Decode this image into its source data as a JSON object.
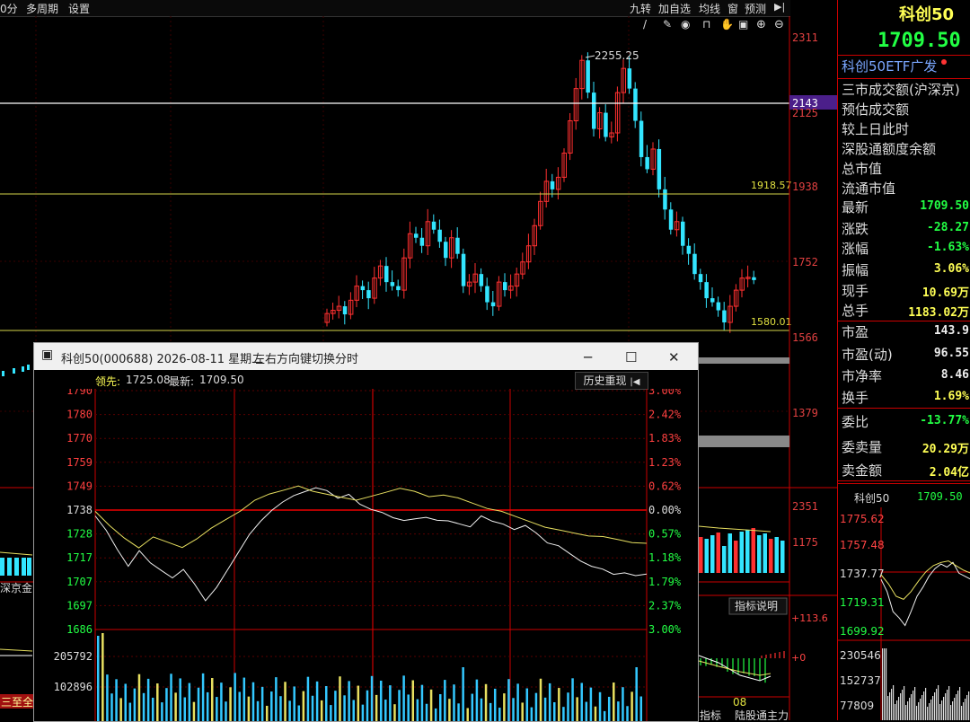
{
  "toolbar": {
    "left_items": [
      "0分",
      "多周期",
      "设置"
    ],
    "right_items": [
      "九转",
      "加自选",
      "均线",
      "窗",
      "预测"
    ]
  },
  "main_chart": {
    "price_axis": [
      "2311",
      "2143",
      "2125",
      "1938",
      "1752",
      "1566",
      "1379"
    ],
    "highlight_price": "2143",
    "annotation_high": "2255.25",
    "line_label_upper": "1918.57",
    "line_label_lower": "1580.01",
    "volume_axis": [
      "2351",
      "1175"
    ],
    "indicator_btn": "指标说明",
    "indicator_axis": [
      "+113.6",
      "+0"
    ],
    "date_label": "08",
    "bottom_tabs": [
      "指标",
      "陆股通主力"
    ],
    "left_bottom_label": "深京金",
    "left_bottom_badge": "三至全"
  },
  "right_panel": {
    "title": "科创50",
    "price": "1709.50",
    "etf": "科创50ETF广发",
    "info_rows": [
      "三市成交额(沪深京)",
      "预估成交额",
      "较上日此时",
      "深股通额度余额",
      "总市值",
      "流通市值"
    ],
    "stats": [
      {
        "label": "最新",
        "value": "1709.50",
        "color": "#22ff44"
      },
      {
        "label": "涨跌",
        "value": "-28.27",
        "color": "#22ff44"
      },
      {
        "label": "涨幅",
        "value": "-1.63%",
        "color": "#22ff44"
      },
      {
        "label": "振幅",
        "value": "3.06%",
        "color": "#ffff55"
      },
      {
        "label": "现手",
        "value": "10.69万",
        "color": "#ffff55"
      },
      {
        "label": "总手",
        "value": "1183.02万",
        "color": "#ffff55"
      },
      {
        "label": "市盈",
        "value": "143.9",
        "color": "#eeeeee"
      },
      {
        "label": "市盈(动)",
        "value": "96.55",
        "color": "#eeeeee"
      },
      {
        "label": "市净率",
        "value": "8.46",
        "color": "#eeeeee"
      },
      {
        "label": "换手",
        "value": "1.69%",
        "color": "#ffff55"
      },
      {
        "label": "委比",
        "value": "-13.77%",
        "color": "#22ff44"
      },
      {
        "label": "委卖量",
        "value": "20.29万",
        "color": "#ffff55"
      },
      {
        "label": "卖金额",
        "value": "2.04亿",
        "color": "#ffff55"
      }
    ],
    "mini_title": "科创50",
    "mini_price": "1709.50",
    "mini_axis": [
      "1775.62",
      "1757.48",
      "1737.77",
      "1719.31",
      "1699.92"
    ],
    "mini_vol_axis": [
      "230546",
      "152737",
      "77809"
    ]
  },
  "popup": {
    "title": "科创50(000688) 2026-08-11 星期二",
    "hint": "左右方向键切换分时",
    "lead_label": "领先:",
    "lead_value": "1725.08",
    "latest_label": "最新:",
    "latest_value": "1709.50",
    "history_btn": "历史重现",
    "price_axis": [
      "1790",
      "1780",
      "1770",
      "1759",
      "1749",
      "1738",
      "1728",
      "1717",
      "1707",
      "1697",
      "1686"
    ],
    "pct_axis": [
      "3.00%",
      "2.42%",
      "1.83%",
      "1.23%",
      "0.62%",
      "0.00%",
      "0.57%",
      "1.18%",
      "1.79%",
      "2.37%",
      "3.00%"
    ],
    "volume_axis": [
      "205792",
      "102896"
    ]
  }
}
